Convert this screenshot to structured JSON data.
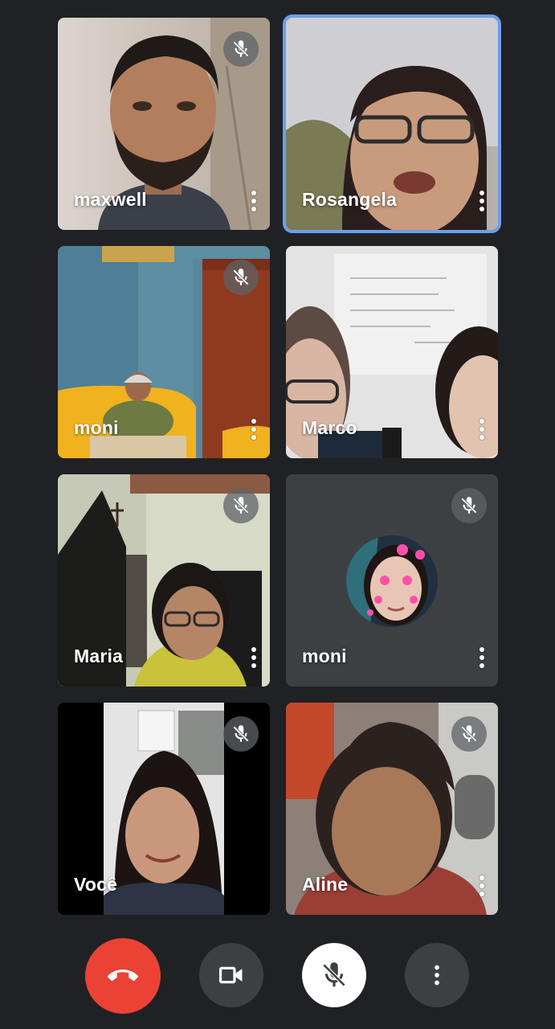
{
  "participants": [
    {
      "name": "maxwell",
      "muted": true,
      "active": false
    },
    {
      "name": "Rosangela",
      "muted": false,
      "active": true
    },
    {
      "name": "moni",
      "muted": true,
      "active": false
    },
    {
      "name": "Marco",
      "muted": false,
      "active": false
    },
    {
      "name": "Maria",
      "muted": true,
      "active": false
    },
    {
      "name": "moni",
      "muted": true,
      "active": false,
      "camera_off": true
    },
    {
      "name": "Você",
      "muted": true,
      "active": false
    },
    {
      "name": "Aline",
      "muted": true,
      "active": false
    }
  ],
  "controls": {
    "end_call": {
      "icon": "phone-hangup-icon",
      "color": "#ea4335"
    },
    "camera": {
      "icon": "videocam-icon",
      "color": "#3c4043"
    },
    "microphone": {
      "icon": "mic-off-icon",
      "color": "#ffffff"
    },
    "more": {
      "icon": "more-vert-icon",
      "color": "#3c4043"
    }
  },
  "colors": {
    "background": "#202124",
    "active_speaker_border": "#6d9eeb"
  }
}
